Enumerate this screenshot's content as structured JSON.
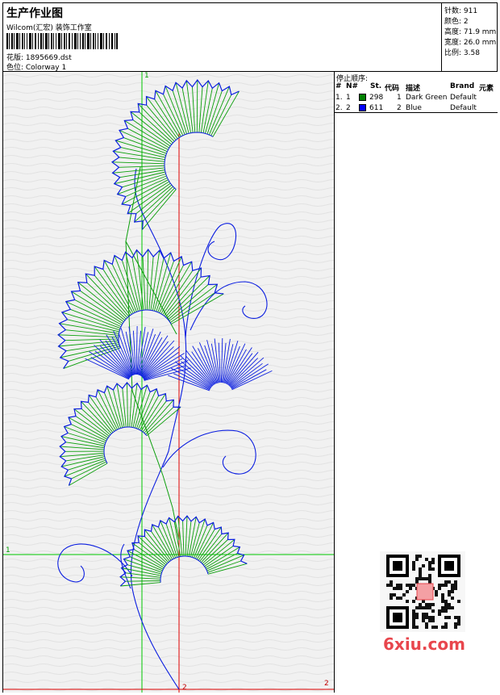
{
  "header": {
    "title": "生产作业图",
    "company": "Wilcom(汇宏) 装饰工作室",
    "design_label": "花版: 1895669.dst",
    "colorway_label": "色位: Colorway 1"
  },
  "stats": {
    "stitches": "针数: 911",
    "colors": "颜色: 2",
    "height": "高度: 71.9 mm",
    "width": "宽度: 26.0 mm",
    "ratio": "比例: 3.58"
  },
  "stop_sequence": {
    "title": "停止顺序:",
    "columns": [
      "#",
      "N#",
      "St.",
      "代码",
      "描述",
      "Brand",
      "元素"
    ],
    "rows": [
      {
        "idx": "1.",
        "n": "1",
        "stitch": "298",
        "code": "1",
        "desc": "Dark Green",
        "brand": "Default",
        "color": "#008000"
      },
      {
        "idx": "2.",
        "n": "2",
        "stitch": "611",
        "code": "2",
        "desc": "Blue",
        "brand": "Default",
        "color": "#0000ff"
      }
    ]
  },
  "axes": {
    "top_marker": "1",
    "left_marker": "1",
    "bottom_marker": "2",
    "right_marker": "2"
  },
  "watermark": {
    "text": "6xiu.com"
  },
  "colors": {
    "green_thread": "#0a9e0a",
    "blue_thread": "#0b1ee0",
    "axis_green": "#00c800",
    "axis_red": "#e00000"
  }
}
